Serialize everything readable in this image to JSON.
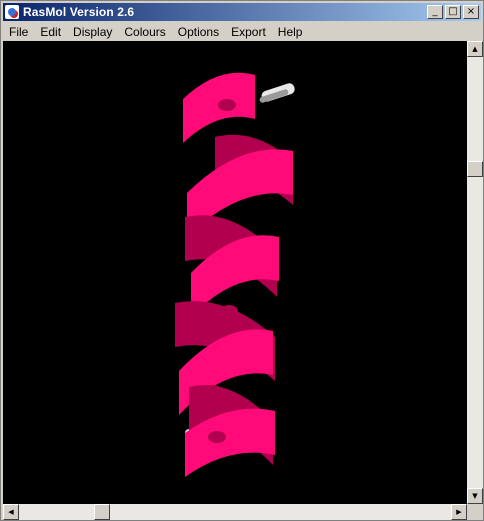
{
  "window": {
    "title": "RasMol Version 2.6",
    "minimize_glyph": "_",
    "maximize_glyph": "□",
    "close_glyph": "×"
  },
  "menu": {
    "items": [
      "File",
      "Edit",
      "Display",
      "Colours",
      "Options",
      "Export",
      "Help"
    ]
  },
  "molecule": {
    "ribbon_color": "#ff0a78",
    "ribbon_shade": "#b0004e",
    "sidechain_color": "#e8e8e8",
    "background_color": "#000000"
  },
  "scrollbars": {
    "up_glyph": "▲",
    "down_glyph": "▼",
    "left_glyph": "◀",
    "right_glyph": "▶",
    "vertical_position": 0.25,
    "horizontal_position": 0.18
  }
}
